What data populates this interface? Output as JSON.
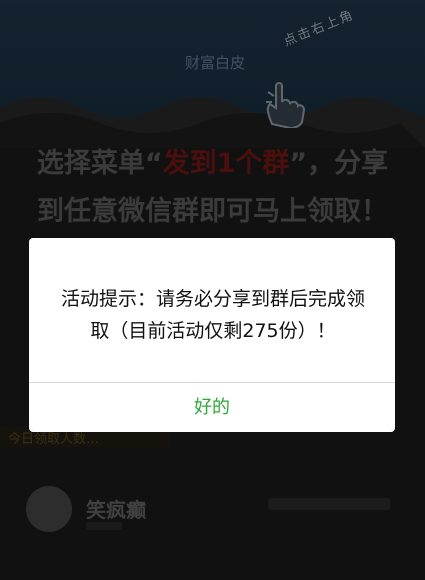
{
  "banner": {
    "title": "财富白皮",
    "hint": "点击右上角"
  },
  "promo": {
    "line1_prefix": "选择菜单“",
    "line1_highlight": "发到1个群",
    "line1_suffix": "”，分享",
    "line2": "到任意微信群即可马上领取！"
  },
  "background": {
    "strip_text": "今日领取人数…",
    "author_name": "笑疯癫"
  },
  "dialog": {
    "message": "活动提示：请务必分享到群后完成领取（目前活动仅剩275份）！",
    "ok_label": "好的"
  },
  "colors": {
    "ok_green": "#2fa73a",
    "promo_red": "#7a1a16"
  }
}
